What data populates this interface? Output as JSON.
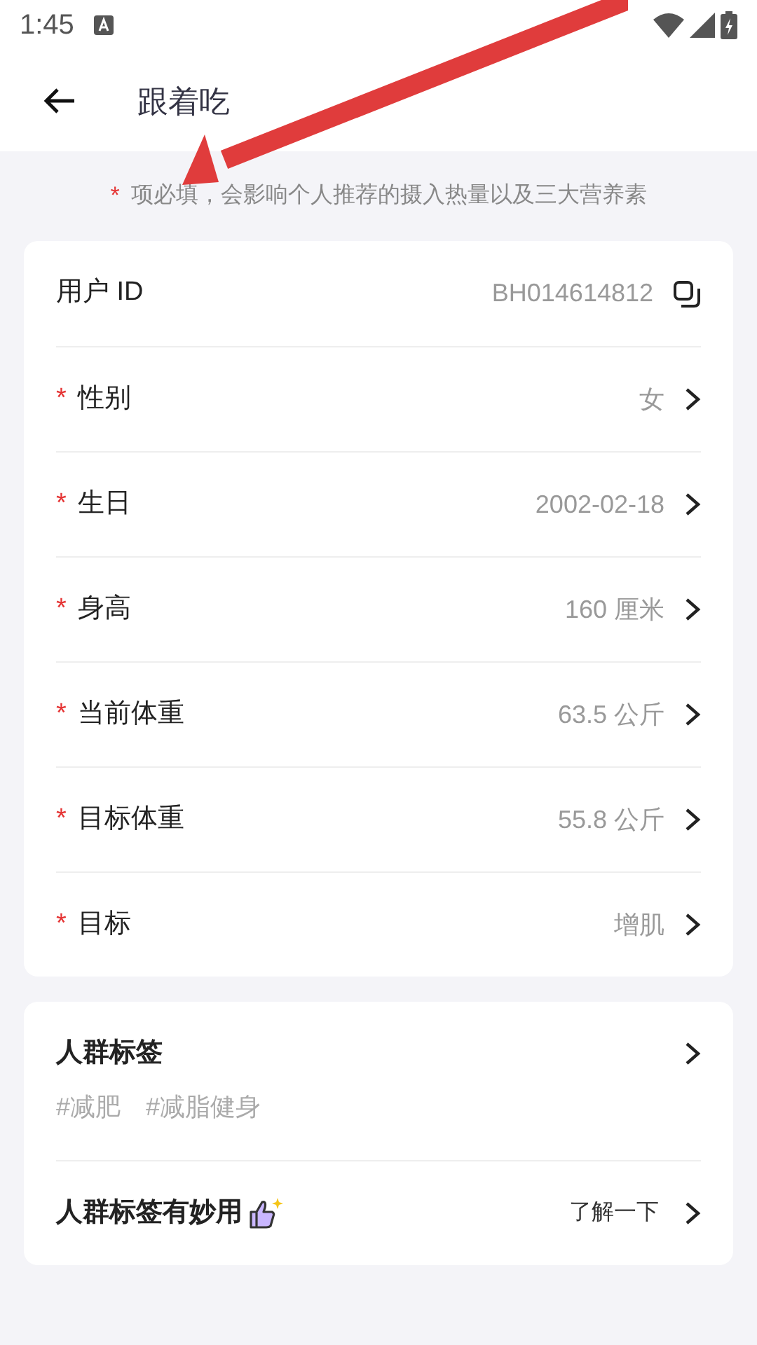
{
  "status_bar": {
    "time": "1:45"
  },
  "header": {
    "title": "跟着吃"
  },
  "notice": {
    "mark": "*",
    "text": "项必填，会影响个人推荐的摄入热量以及三大营养素"
  },
  "profile_rows": [
    {
      "kind": "copy",
      "required": false,
      "label": "用户 ID",
      "value": "BH014614812"
    },
    {
      "kind": "link",
      "required": true,
      "label": "性别",
      "value": "女"
    },
    {
      "kind": "link",
      "required": true,
      "label": "生日",
      "value": "2002-02-18"
    },
    {
      "kind": "link",
      "required": true,
      "label": "身高",
      "value": "160 厘米"
    },
    {
      "kind": "link",
      "required": true,
      "label": "当前体重",
      "value": "63.5 公斤"
    },
    {
      "kind": "link",
      "required": true,
      "label": "目标体重",
      "value": "55.8 公斤"
    },
    {
      "kind": "link",
      "required": true,
      "label": "目标",
      "value": "增肌"
    }
  ],
  "tags_card": {
    "title": "人群标签",
    "tags": [
      "#减肥",
      "#减脂健身"
    ],
    "tip": {
      "label": "人群标签有妙用",
      "link": "了解一下"
    }
  }
}
